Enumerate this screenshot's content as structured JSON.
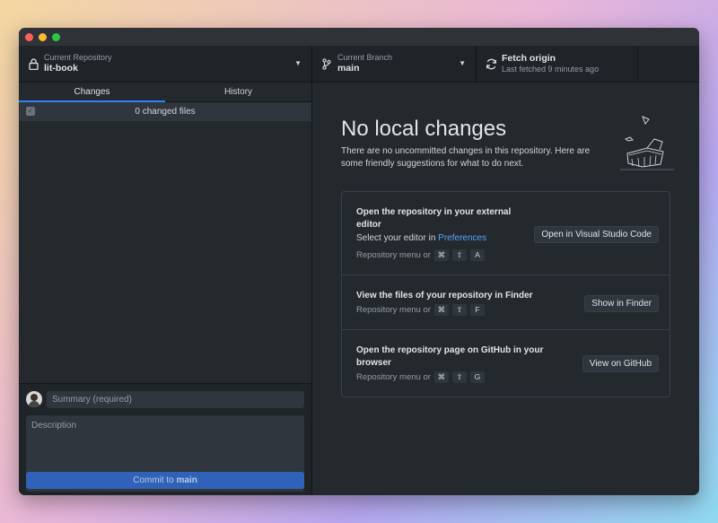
{
  "toolbar": {
    "repo_label": "Current Repository",
    "repo_name": "lit-book",
    "branch_label": "Current Branch",
    "branch_name": "main",
    "fetch_title": "Fetch origin",
    "fetch_sub": "Last fetched 9 minutes ago"
  },
  "tabs": {
    "changes": "Changes",
    "history": "History"
  },
  "changes": {
    "count_text": "0 changed files"
  },
  "commit": {
    "summary_placeholder": "Summary (required)",
    "description_placeholder": "Description",
    "button_prefix": "Commit to ",
    "button_branch": "main"
  },
  "main": {
    "title": "No local changes",
    "description": "There are no uncommitted changes in this repository. Here are some friendly suggestions for what to do next."
  },
  "suggestions": [
    {
      "title": "Open the repository in your external editor",
      "sub_prefix": "Select your editor in ",
      "sub_link": "Preferences",
      "shortcut_prefix": "Repository menu or",
      "keys": [
        "⌘",
        "⇧",
        "A"
      ],
      "button": "Open in Visual Studio Code"
    },
    {
      "title": "View the files of your repository in Finder",
      "shortcut_prefix": "Repository menu or",
      "keys": [
        "⌘",
        "⇧",
        "F"
      ],
      "button": "Show in Finder"
    },
    {
      "title": "Open the repository page on GitHub in your browser",
      "shortcut_prefix": "Repository menu or",
      "keys": [
        "⌘",
        "⇧",
        "G"
      ],
      "button": "View on GitHub"
    }
  ],
  "icons": {
    "lock": "lock-icon",
    "branch": "git-branch-icon",
    "sync": "sync-icon",
    "caret": "chevron-down-icon",
    "coauthor": "person-add-icon"
  },
  "colors": {
    "accent": "#2f81f7",
    "commit_button": "#2f62b8",
    "link": "#58a6ff",
    "background": "#24292e"
  }
}
